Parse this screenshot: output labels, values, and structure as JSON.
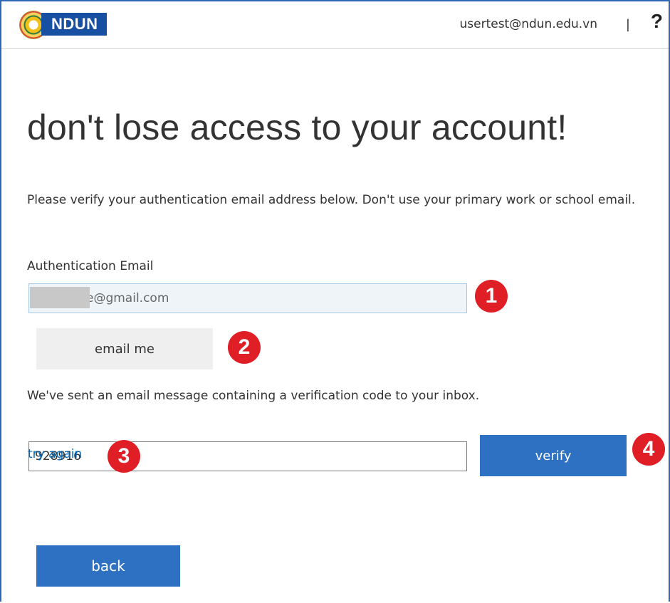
{
  "header": {
    "brand": "NDUN",
    "logo_seal": "university-seal",
    "user_email": "usertest@ndun.edu.vn",
    "divider": "|",
    "help_icon": "?"
  },
  "main": {
    "title": "don't lose access to your account!",
    "instructions": "Please verify your authentication email address below. Don't use your primary work or school email.",
    "email_label": "Authentication Email",
    "email_value": "e@gmail.com",
    "email_me_label": "email me",
    "sent_message": "We've sent an email message containing a verification code to your inbox.",
    "code_value": "928916",
    "verify_label": "verify",
    "try_again_label": "try again",
    "back_label": "back"
  },
  "callouts": {
    "one": "1",
    "two": "2",
    "three": "3",
    "four": "4"
  },
  "colors": {
    "primary_button": "#2e70c1",
    "link": "#0067b8",
    "callout": "#e01e26",
    "brand_background": "#1750a3"
  }
}
